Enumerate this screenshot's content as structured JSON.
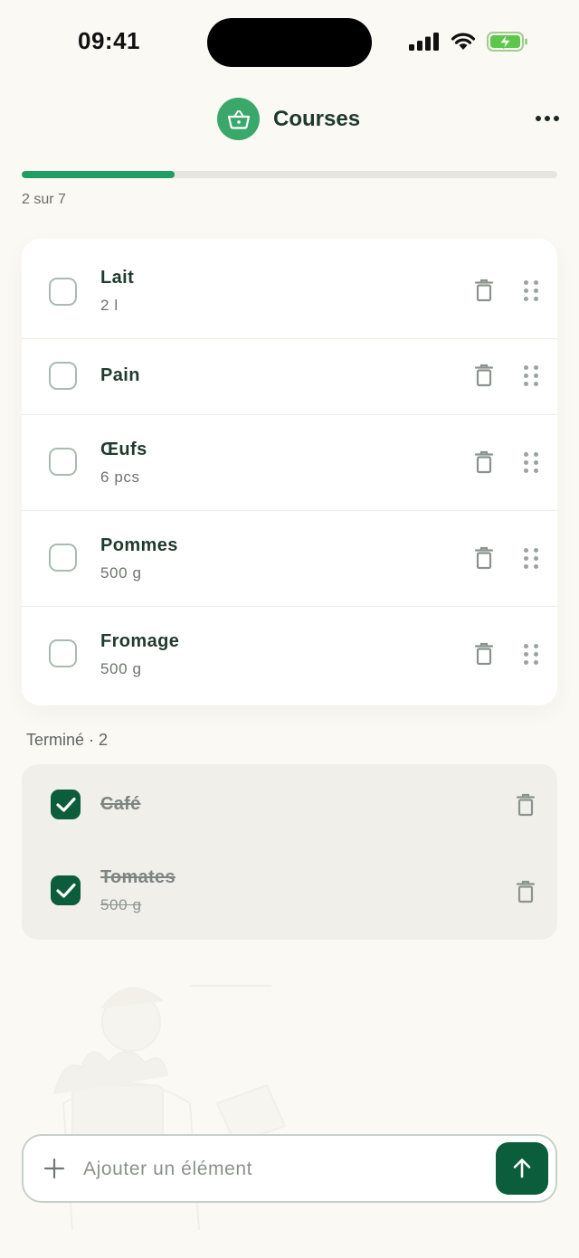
{
  "status_bar": {
    "time": "09:41"
  },
  "header": {
    "title": "Courses"
  },
  "progress": {
    "label": "2 sur 7",
    "completed": 2,
    "total": 7
  },
  "items": [
    {
      "name": "Lait",
      "qty": "2 l"
    },
    {
      "name": "Pain",
      "qty": ""
    },
    {
      "name": "Œufs",
      "qty": "6 pcs"
    },
    {
      "name": "Pommes",
      "qty": "500 g"
    },
    {
      "name": "Fromage",
      "qty": "500 g"
    }
  ],
  "done": {
    "label": "Terminé · 2",
    "items": [
      {
        "name": "Café",
        "qty": ""
      },
      {
        "name": "Tomates",
        "qty": "500 g"
      }
    ]
  },
  "input": {
    "placeholder": "Ajouter un élément"
  },
  "colors": {
    "accent": "#1f9d63",
    "dark_green": "#0b5d3b",
    "background": "#faf9f4"
  }
}
